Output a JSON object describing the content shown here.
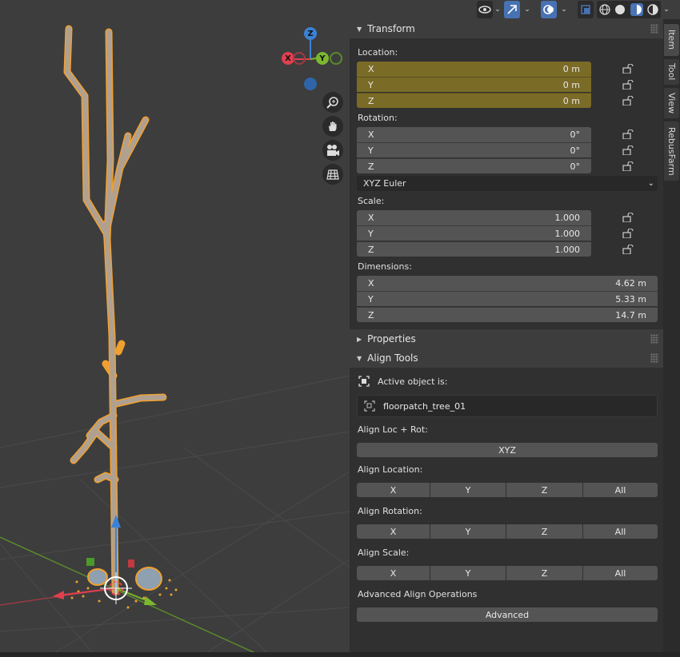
{
  "header": {
    "visibility_icon": "eye-icon",
    "gizmo_toggle_icon": "gizmo-arrow-icon",
    "overlay_icon": "overlay-icon",
    "xray_icon": "xray-icon",
    "shading_modes": [
      "wireframe-icon",
      "solid-icon",
      "material-preview-icon",
      "rendered-icon"
    ]
  },
  "gizmo": {
    "z": "Z",
    "y": "Y",
    "x": "X"
  },
  "nav_buttons": [
    "zoom-icon",
    "hand-pan-icon",
    "camera-icon",
    "grid-ortho-icon"
  ],
  "transform": {
    "title": "Transform",
    "location": {
      "label": "Location:",
      "rows": [
        {
          "axis": "X",
          "value": "0 m"
        },
        {
          "axis": "Y",
          "value": "0 m"
        },
        {
          "axis": "Z",
          "value": "0 m"
        }
      ]
    },
    "rotation": {
      "label": "Rotation:",
      "rows": [
        {
          "axis": "X",
          "value": "0°"
        },
        {
          "axis": "Y",
          "value": "0°"
        },
        {
          "axis": "Z",
          "value": "0°"
        }
      ]
    },
    "rotation_mode": "XYZ Euler",
    "scale": {
      "label": "Scale:",
      "rows": [
        {
          "axis": "X",
          "value": "1.000"
        },
        {
          "axis": "Y",
          "value": "1.000"
        },
        {
          "axis": "Z",
          "value": "1.000"
        }
      ]
    },
    "dimensions": {
      "label": "Dimensions:",
      "rows": [
        {
          "axis": "X",
          "value": "4.62 m"
        },
        {
          "axis": "Y",
          "value": "5.33 m"
        },
        {
          "axis": "Z",
          "value": "14.7 m"
        }
      ]
    }
  },
  "properties": {
    "title": "Properties"
  },
  "align_tools": {
    "title": "Align Tools",
    "active_label": "Active object is:",
    "active_object": "floorpatch_tree_01",
    "loc_rot": {
      "label": "Align Loc + Rot:",
      "button": "XYZ"
    },
    "location": {
      "label": "Align Location:",
      "buttons": [
        "X",
        "Y",
        "Z",
        "All"
      ]
    },
    "rotation": {
      "label": "Align Rotation:",
      "buttons": [
        "X",
        "Y",
        "Z",
        "All"
      ]
    },
    "scale": {
      "label": "Align Scale:",
      "buttons": [
        "X",
        "Y",
        "Z",
        "All"
      ]
    },
    "advanced": {
      "label": "Advanced Align Operations",
      "button": "Advanced"
    }
  },
  "tabs": [
    "Item",
    "Tool",
    "View",
    "RebusFarm"
  ],
  "colors": {
    "accent": "#4772b3",
    "selection_outline": "#f0a030",
    "locked_field": "#7a6b27",
    "axis_x": "#e0404f",
    "axis_y": "#7cb82f",
    "axis_z": "#3b82d6"
  }
}
